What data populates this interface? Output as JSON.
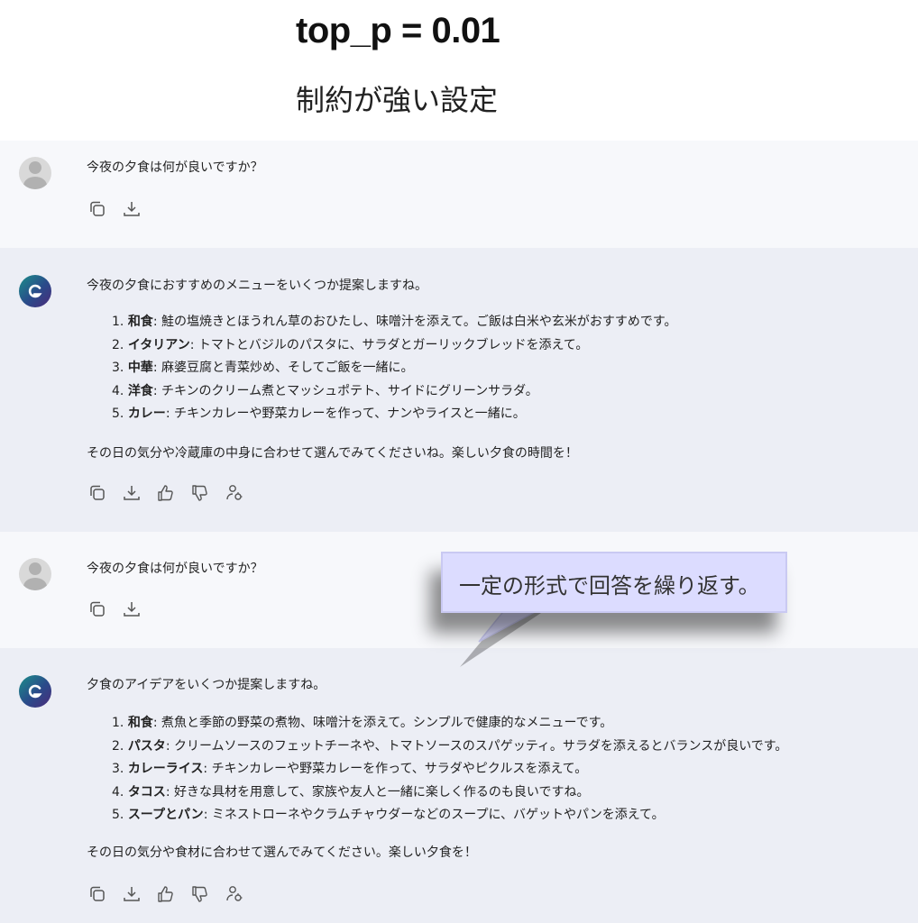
{
  "header": {
    "title": "top_p = 0.01",
    "subtitle": "制約が強い設定"
  },
  "conversation": {
    "m1": {
      "text": "今夜の夕食は何が良いですか？"
    },
    "m2": {
      "intro": "今夜の夕食におすすめのメニューをいくつか提案しますね。",
      "items": [
        {
          "num": "1.",
          "title": "和食",
          "desc": ": 鮭の塩焼きとほうれん草のおひたし、味噌汁を添えて。ご飯は白米や玄米がおすすめです。"
        },
        {
          "num": "2.",
          "title": "イタリアン",
          "desc": ": トマトとバジルのパスタに、サラダとガーリックブレッドを添えて。"
        },
        {
          "num": "3.",
          "title": "中華",
          "desc": ": 麻婆豆腐と青菜炒め、そしてご飯を一緒に。"
        },
        {
          "num": "4.",
          "title": "洋食",
          "desc": ": チキンのクリーム煮とマッシュポテト、サイドにグリーンサラダ。"
        },
        {
          "num": "5.",
          "title": "カレー",
          "desc": ": チキンカレーや野菜カレーを作って、ナンやライスと一緒に。"
        }
      ],
      "outro": "その日の気分や冷蔵庫の中身に合わせて選んでみてくださいね。楽しい夕食の時間を！"
    },
    "m3": {
      "text": "今夜の夕食は何が良いですか？"
    },
    "m4": {
      "intro": "夕食のアイデアをいくつか提案しますね。",
      "items": [
        {
          "num": "1.",
          "title": "和食",
          "desc": ": 煮魚と季節の野菜の煮物、味噌汁を添えて。シンプルで健康的なメニューです。"
        },
        {
          "num": "2.",
          "title": "パスタ",
          "desc": ": クリームソースのフェットチーネや、トマトソースのスパゲッティ。サラダを添えるとバランスが良いです。"
        },
        {
          "num": "3.",
          "title": "カレーライス",
          "desc": ": チキンカレーや野菜カレーを作って、サラダやピクルスを添えて。"
        },
        {
          "num": "4.",
          "title": "タコス",
          "desc": ": 好きな具材を用意して、家族や友人と一緒に楽しく作るのも良いですね。"
        },
        {
          "num": "5.",
          "title": "スープとパン",
          "desc": ": ミネストローネやクラムチャウダーなどのスープに、バゲットやパンを添えて。"
        }
      ],
      "outro": "その日の気分や食材に合わせて選んでみてください。楽しい夕食を！"
    }
  },
  "callout": {
    "text": "一定の形式で回答を繰り返す。"
  },
  "icons": {
    "user_avatar": "user-avatar-icon",
    "bot_avatar": "assistant-logo-icon",
    "copy": "copy-icon",
    "download": "download-icon",
    "thumbs_up": "thumbs-up-icon",
    "thumbs_down": "thumbs-down-icon",
    "speaker": "speaker-icon"
  },
  "colors": {
    "user_bg": "#f7f8fb",
    "bot_bg": "#eceef5",
    "callout_bg": "#dcdcff"
  }
}
